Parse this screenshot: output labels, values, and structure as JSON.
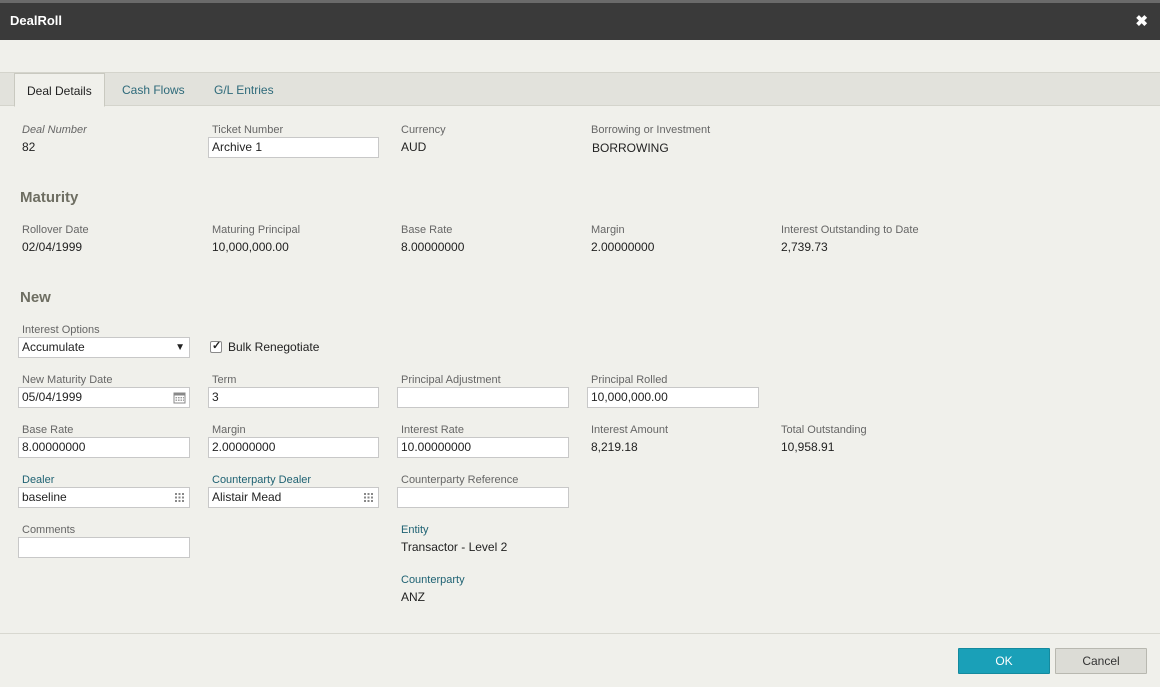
{
  "window": {
    "title": "DealRoll",
    "close_glyph": "✖"
  },
  "tabs": [
    {
      "label": "Deal Details"
    },
    {
      "label": "Cash Flows"
    },
    {
      "label": "G/L Entries"
    }
  ],
  "deal": {
    "deal_number_label": "Deal Number",
    "deal_number": "82",
    "ticket_number_label": "Ticket Number",
    "ticket_number": "Archive 1",
    "currency_label": "Currency",
    "currency": "AUD",
    "borrowing_label": "Borrowing or Investment",
    "borrowing": "BORROWING"
  },
  "maturity": {
    "heading": "Maturity",
    "rollover_date_label": "Rollover Date",
    "rollover_date": "02/04/1999",
    "maturing_principal_label": "Maturing Principal",
    "maturing_principal": "10,000,000.00",
    "base_rate_label": "Base Rate",
    "base_rate": "8.00000000",
    "margin_label": "Margin",
    "margin": "2.00000000",
    "interest_outstanding_label": "Interest Outstanding to Date",
    "interest_outstanding": "2,739.73"
  },
  "new": {
    "heading": "New",
    "interest_options_label": "Interest Options",
    "interest_options": "Accumulate",
    "bulk_renegotiate_label": "Bulk Renegotiate",
    "bulk_renegotiate_checked": true,
    "new_maturity_date_label": "New Maturity Date",
    "new_maturity_date": "05/04/1999",
    "term_label": "Term",
    "term": "3",
    "principal_adjustment_label": "Principal Adjustment",
    "principal_adjustment": "",
    "principal_rolled_label": "Principal Rolled",
    "principal_rolled": "10,000,000.00",
    "base_rate_label": "Base Rate",
    "base_rate": "8.00000000",
    "margin_label": "Margin",
    "margin": "2.00000000",
    "interest_rate_label": "Interest Rate",
    "interest_rate": "10.00000000",
    "interest_amount_label": "Interest Amount",
    "interest_amount": "8,219.18",
    "total_outstanding_label": "Total Outstanding",
    "total_outstanding": "10,958.91",
    "dealer_label": "Dealer",
    "dealer": "baseline",
    "counterparty_dealer_label": "Counterparty Dealer",
    "counterparty_dealer": "Alistair Mead",
    "counterparty_reference_label": "Counterparty Reference",
    "counterparty_reference": "",
    "comments_label": "Comments",
    "comments": "",
    "entity_label": "Entity",
    "entity": "Transactor - Level 2",
    "counterparty_label": "Counterparty",
    "counterparty": "ANZ"
  },
  "buttons": {
    "ok": "OK",
    "cancel": "Cancel"
  },
  "icons": {
    "close": "close-icon",
    "calendar": "calendar-icon",
    "grid": "grid-picker-icon",
    "dropdown": "chevron-down-icon",
    "check": "checkmark-icon"
  },
  "colors": {
    "titlebar": "#3a3a3a",
    "accent": "#1aa0b8",
    "link": "#1f6273"
  }
}
